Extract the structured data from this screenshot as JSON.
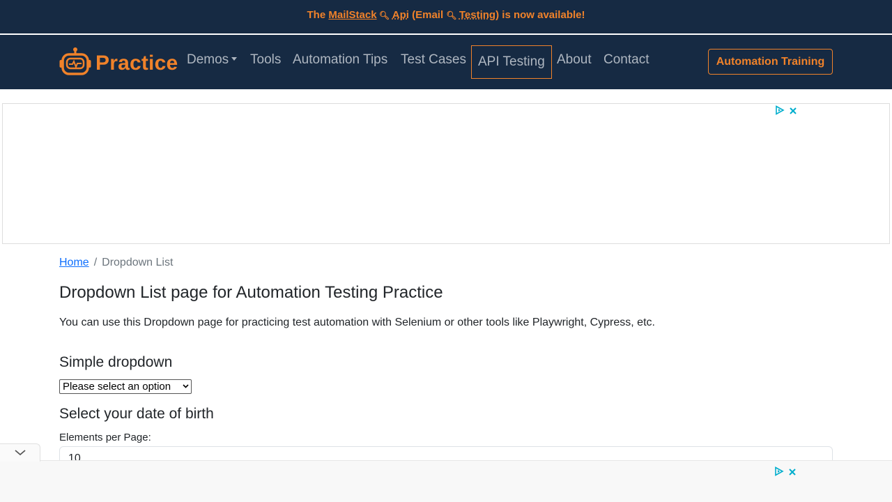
{
  "announcement": {
    "prefix": "The ",
    "link1": "MailStack",
    "mid1": " ",
    "link2": "Api",
    "mid2": " (Email ",
    "link3": "Testing",
    "suffix": ") is now available!",
    "search_icon": "magnifier-icon"
  },
  "navbar": {
    "brand": "Practice",
    "logo_icon": "robot-icon",
    "items": [
      "Demos",
      "Tools",
      "Automation Tips",
      "Test Cases",
      "API Testing",
      "About",
      "Contact"
    ],
    "cta": "Automation Training"
  },
  "ads": {
    "top_icons": [
      "adchoices-icon",
      "close-icon"
    ],
    "bottom_icons": [
      "adchoices-icon",
      "close-icon"
    ]
  },
  "breadcrumb": {
    "home": "Home",
    "separator": "/",
    "current": "Dropdown List"
  },
  "main": {
    "title": "Dropdown List page for Automation Testing Practice",
    "intro": "You can use this Dropdown page for practicing test automation with Selenium or other tools like Playwright, Cypress, etc.",
    "simple_heading": "Simple dropdown",
    "simple_select_value": "Please select an option",
    "dob_heading": "Select your date of birth",
    "elements_label": "Elements per Page:",
    "elements_value": "10"
  },
  "colors": {
    "navy": "#162a43",
    "accent": "#f0822a",
    "nav_text": "#aeb6c0",
    "link": "#0d6efd"
  }
}
